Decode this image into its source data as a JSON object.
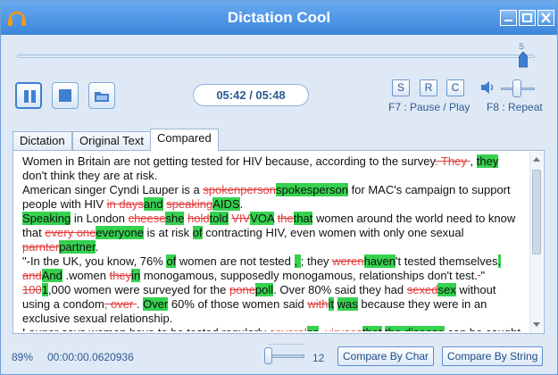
{
  "window": {
    "title": "Dictation Cool"
  },
  "player": {
    "seek_marker": "S",
    "time": "05:42 / 05:48",
    "keys": [
      "S",
      "R",
      "C"
    ],
    "hint_pause": "F7 : Pause / Play",
    "hint_repeat": "F8 : Repeat"
  },
  "tabs": [
    "Dictation",
    "Original Text",
    "Compared"
  ],
  "active_tab": "Compared",
  "colors": {
    "added": "#35d14f",
    "removed": "#e23d3d",
    "accent": "#3d86dc"
  },
  "compared_lines": [
    [
      {
        "t": "Women in Britain are not getting tested for HIV because, according to the survey"
      },
      {
        "t": ". They ",
        "k": "del"
      },
      {
        "t": ", "
      },
      {
        "t": "they",
        "k": "add"
      }
    ],
    [
      {
        "t": "don't think they are at risk."
      }
    ],
    [
      {
        "t": "American singer Cyndi Lauper is a "
      },
      {
        "t": "spokenperson",
        "k": "del"
      },
      {
        "t": "spokesperson",
        "k": "add"
      },
      {
        "t": " for MAC's campaign to support"
      }
    ],
    [
      {
        "t": "people with HIV "
      },
      {
        "t": "in days",
        "k": "del"
      },
      {
        "t": "and",
        "k": "add"
      },
      {
        "t": " "
      },
      {
        "t": "speaking",
        "k": "del"
      },
      {
        "t": "AIDS",
        "k": "add"
      },
      {
        "t": "."
      }
    ],
    [
      {
        "t": "Speaking",
        "k": "add"
      },
      {
        "t": " in London "
      },
      {
        "t": "cheese",
        "k": "del"
      },
      {
        "t": "she",
        "k": "add"
      },
      {
        "t": " "
      },
      {
        "t": "hold",
        "k": "del"
      },
      {
        "t": "told",
        "k": "add"
      },
      {
        "t": " "
      },
      {
        "t": "VIV",
        "k": "del"
      },
      {
        "t": "VOA",
        "k": "add"
      },
      {
        "t": " "
      },
      {
        "t": "the",
        "k": "del"
      },
      {
        "t": "that",
        "k": "add"
      },
      {
        "t": " women around the world need to know"
      }
    ],
    [
      {
        "t": "that "
      },
      {
        "t": "every one",
        "k": "del"
      },
      {
        "t": "everyone",
        "k": "add"
      },
      {
        "t": " is at risk "
      },
      {
        "t": "of",
        "k": "add"
      },
      {
        "t": " contracting HIV, even women with only one sexual"
      }
    ],
    [
      {
        "t": "parnter",
        "k": "del"
      },
      {
        "t": "partner",
        "k": "add"
      },
      {
        "t": "."
      }
    ],
    [
      {
        "t": "\"-In the UK, you know, 76% "
      },
      {
        "t": "of",
        "k": "add"
      },
      {
        "t": " women are not tested "
      },
      {
        "t": ", ",
        "k": "add"
      },
      {
        "t": "; they "
      },
      {
        "t": "weren",
        "k": "del"
      },
      {
        "t": "haven",
        "k": "add"
      },
      {
        "t": "'t tested themselves"
      },
      {
        "t": ".",
        "k": "add"
      }
    ],
    [
      {
        "t": "and",
        "k": "del"
      },
      {
        "t": "And",
        "k": "add"
      },
      {
        "t": " .women "
      },
      {
        "t": "they",
        "k": "del"
      },
      {
        "t": "in",
        "k": "add"
      },
      {
        "t": " monogamous, supposedly monogamous, relationships don't test."
      },
      {
        "t": " ",
        "k": "del"
      },
      {
        "t": "\""
      }
    ],
    [
      {
        "t": "100",
        "k": "del"
      },
      {
        "t": "1",
        "k": "add"
      },
      {
        "t": ",000 women were surveyed for the "
      },
      {
        "t": "pone",
        "k": "del"
      },
      {
        "t": "poll",
        "k": "add"
      },
      {
        "t": ". Over 80% said they had "
      },
      {
        "t": "sexed",
        "k": "del"
      },
      {
        "t": "sex",
        "k": "add"
      },
      {
        "t": " without"
      }
    ],
    [
      {
        "t": "using a condom"
      },
      {
        "t": ", over ",
        "k": "del"
      },
      {
        "t": ". "
      },
      {
        "t": "Over",
        "k": "add"
      },
      {
        "t": " 60% of those women said "
      },
      {
        "t": "with",
        "k": "del"
      },
      {
        "t": "it",
        "k": "add"
      },
      {
        "t": " "
      },
      {
        "t": "was",
        "k": "add"
      },
      {
        "t": " because they were in an"
      }
    ],
    [
      {
        "t": "exclusive sexual relationship."
      }
    ],
    [
      {
        "t": "Lauper says women have to be tested regularly "
      },
      {
        "t": "several",
        "k": "del"
      },
      {
        "t": "so",
        "k": "add"
      },
      {
        "t": ". "
      },
      {
        "t": "viruses",
        "k": "del"
      },
      {
        "t": "that",
        "k": "add"
      },
      {
        "t": " "
      },
      {
        "t": "the disease",
        "k": "add"
      },
      {
        "t": " can be caught"
      }
    ]
  ],
  "status": {
    "percent": "89%",
    "elapsed": "00:00:00.0620936",
    "slider_value": "12",
    "compare_char": "Compare By Char",
    "compare_string": "Compare By String"
  }
}
